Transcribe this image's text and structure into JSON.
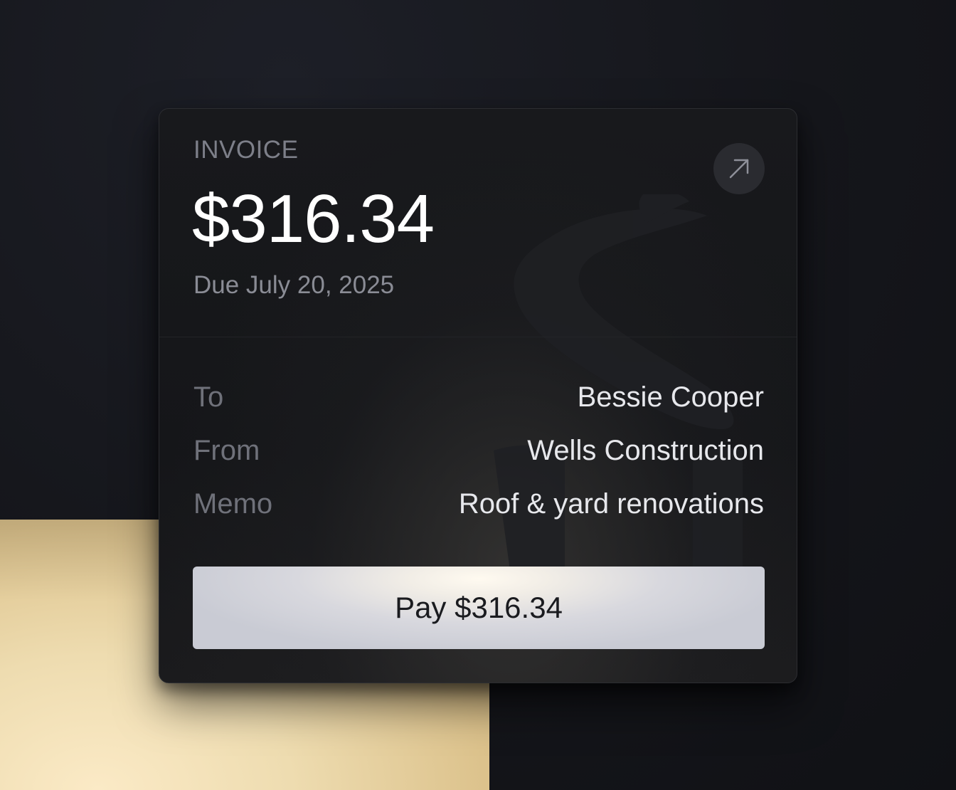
{
  "invoice": {
    "label": "INVOICE",
    "amount": "$316.34",
    "due": "Due July 20, 2025"
  },
  "details": {
    "to_label": "To",
    "to_value": "Bessie Cooper",
    "from_label": "From",
    "from_value": "Wells Construction",
    "memo_label": "Memo",
    "memo_value": "Roof & yard renovations"
  },
  "actions": {
    "pay_label": "Pay $316.34",
    "external_icon": "arrow-up-right-icon"
  },
  "colors": {
    "background": "#15161b",
    "card": "#17181b",
    "accent_gold": "#e8d3a0",
    "button": "#cfd1d9"
  }
}
